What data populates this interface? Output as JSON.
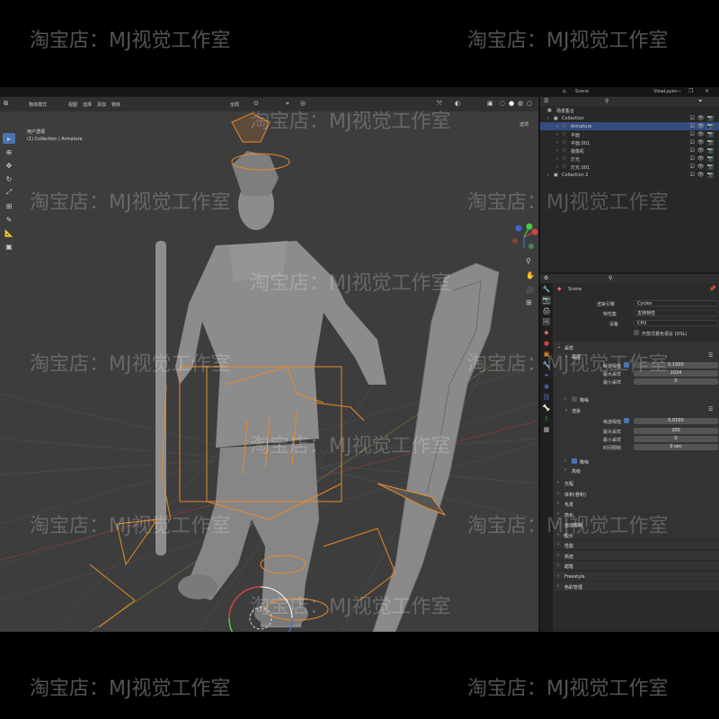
{
  "watermark": "淘宝店：MJ视觉工作室",
  "topbar": {
    "scene": "Scene",
    "view_layer": "ViewLayer"
  },
  "viewport_header": {
    "mode": "物体模式",
    "menus": [
      "视图",
      "选择",
      "添加",
      "物体"
    ],
    "orientation": "全局",
    "options": "选项"
  },
  "viewport_info": {
    "line1": "用户透视",
    "line2": "(1) Collection | Armature"
  },
  "outliner": {
    "root": "场景集合",
    "items": [
      {
        "label": "Collection",
        "indent": 0
      },
      {
        "label": "Armature",
        "indent": 1,
        "selected": true
      },
      {
        "label": "平面",
        "indent": 1
      },
      {
        "label": "平面.001",
        "indent": 1
      },
      {
        "label": "摄像机",
        "indent": 1
      },
      {
        "label": "灯光",
        "indent": 1
      },
      {
        "label": "灯光.001",
        "indent": 1
      },
      {
        "label": "Collection 2",
        "indent": 0
      }
    ]
  },
  "properties": {
    "header": "Scene",
    "render_engine_label": "渲染引擎",
    "render_engine": "Cycles",
    "feature_set_label": "特性集",
    "feature_set": "支持特性",
    "device_label": "设备",
    "device": "CPU",
    "osl_label": "开放式着色语言 (OSL)",
    "sampling_label": "采样",
    "viewport_label": "视图",
    "vp_noise_threshold_label": "噪波阈值",
    "vp_noise_threshold": "0.1000",
    "vp_max_samples_label": "最大采样",
    "vp_max_samples": "1024",
    "vp_min_samples_label": "最小采样",
    "vp_min_samples": "0",
    "denoise_label": "降噪",
    "render_label": "渲染",
    "r_noise_threshold_label": "噪波阈值",
    "r_noise_threshold": "0.0100",
    "r_max_samples_label": "最大采样",
    "r_max_samples": "200",
    "r_min_samples_label": "最小采样",
    "r_min_samples": "0",
    "time_limit_label": "时间限制",
    "time_limit": "0 sec",
    "r_denoise_label": "降噪",
    "advanced_label": "高级",
    "sections": [
      "光程",
      "体积(卷积)",
      "毛发",
      "简化",
      "运动模糊",
      "胶片",
      "性能",
      "烘焙",
      "蜡笔",
      "Freestyle",
      "色彩管理"
    ]
  },
  "colors": {
    "viewport_bg": "#3d3d3d",
    "selection_orange": "#e88a2a",
    "active_blue": "#4a73b0",
    "panel_bg": "#2b2b2b"
  }
}
